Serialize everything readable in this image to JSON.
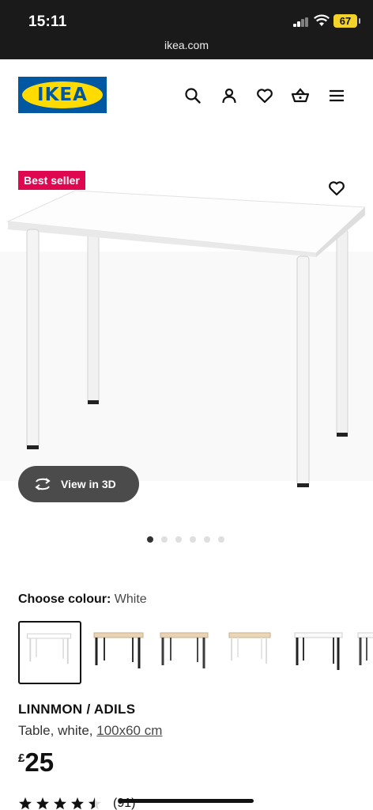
{
  "status_bar": {
    "time": "15:11",
    "battery": "67",
    "url": "ikea.com"
  },
  "header": {
    "logo_text": "IKEA",
    "icons": [
      "search-icon",
      "account-icon",
      "favourites-icon",
      "basket-icon",
      "menu-icon"
    ]
  },
  "product_image": {
    "badge": "Best seller",
    "view_3d_label": "View in 3D",
    "image_count": 6,
    "active_image": 1
  },
  "colour": {
    "label": "Choose colour:",
    "value": "White",
    "options": [
      "white",
      "white-stained oak / black",
      "white-stained oak / dark grey",
      "white-stained oak / white",
      "white / black",
      "white / dark grey"
    ]
  },
  "product": {
    "name": "LINNMON / ADILS",
    "description": "Table, white,",
    "size": "100x60 cm",
    "currency": "£",
    "price": "25",
    "rating": 4.5,
    "review_count": "(91)"
  },
  "colors": {
    "ikea_blue": "#0058a3",
    "ikea_yellow": "#ffdb00",
    "badge_red": "#e00751",
    "button_dark": "#4b4b4b"
  }
}
